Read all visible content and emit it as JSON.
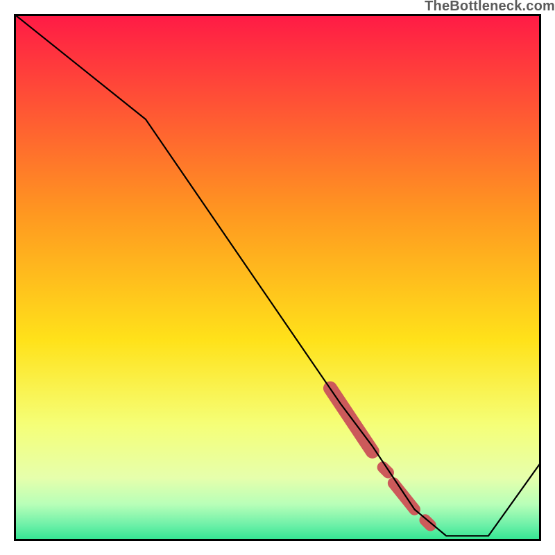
{
  "watermark": "TheBottleneck.com",
  "colors": {
    "top": "#ff1a46",
    "mid1": "#ff9a1f",
    "mid2": "#ffe21a",
    "mid3": "#f6ff7a",
    "mid4": "#d8ffb0",
    "bottom": "#2ee490",
    "line": "#000000",
    "marker": "#cc5a5a",
    "frame": "#000000"
  },
  "chart_data": {
    "type": "line",
    "title": "",
    "xlabel": "",
    "ylabel": "",
    "xlim": [
      0,
      100
    ],
    "ylim": [
      0,
      100
    ],
    "grid": false,
    "series": [
      {
        "name": "curve",
        "x": [
          0,
          25,
          62,
          68,
          70,
          74,
          76,
          82,
          90,
          100
        ],
        "values": [
          100,
          80,
          26,
          18,
          15,
          9,
          6,
          1,
          1,
          15
        ]
      }
    ],
    "markers": [
      {
        "x0": 60,
        "y0": 29,
        "x1": 68,
        "y1": 17,
        "r": 6
      },
      {
        "x0": 70,
        "y0": 14,
        "x1": 71,
        "y1": 13,
        "r": 5
      },
      {
        "x0": 72,
        "y0": 11,
        "x1": 76,
        "y1": 6,
        "r": 5
      },
      {
        "x0": 78,
        "y0": 4,
        "x1": 79,
        "y1": 3,
        "r": 5
      }
    ],
    "gradient_stops": [
      {
        "offset": 0.0,
        "color": "#ff1a46"
      },
      {
        "offset": 0.38,
        "color": "#ff9820"
      },
      {
        "offset": 0.62,
        "color": "#ffe21a"
      },
      {
        "offset": 0.78,
        "color": "#f5ff78"
      },
      {
        "offset": 0.88,
        "color": "#e6ffac"
      },
      {
        "offset": 0.93,
        "color": "#b8ffb8"
      },
      {
        "offset": 0.97,
        "color": "#6cf0a8"
      },
      {
        "offset": 1.0,
        "color": "#2ee490"
      }
    ]
  }
}
